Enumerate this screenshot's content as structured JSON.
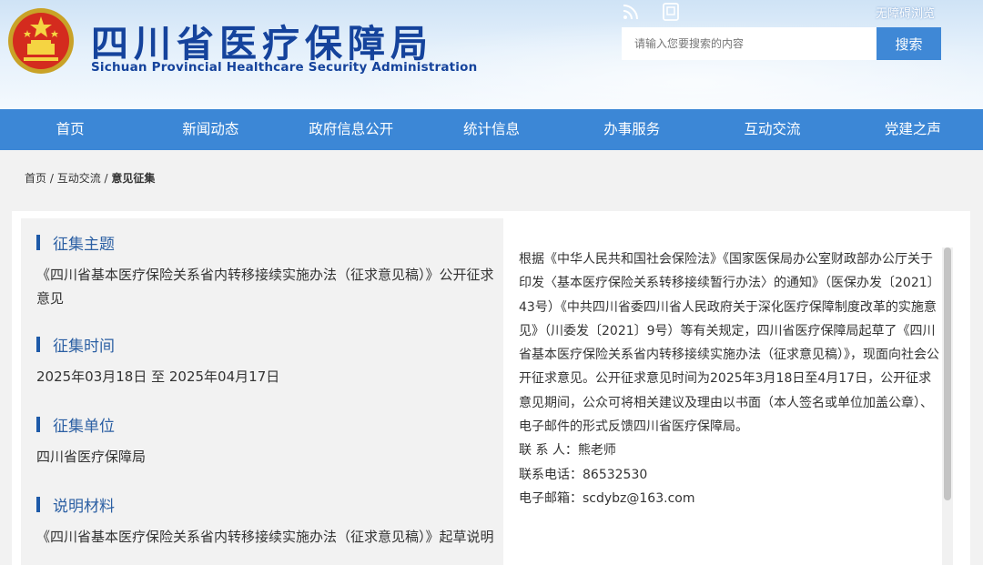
{
  "header": {
    "title": "四川省医疗保障局",
    "subtitle": "Sichuan Provincial Healthcare Security Administration",
    "accessibility": "无障碍浏览",
    "search_placeholder": "请输入您要搜索的内容",
    "search_button": "搜索",
    "icons": [
      "rss-icon",
      "mobile-icon"
    ]
  },
  "nav": {
    "items": [
      "首页",
      "新闻动态",
      "政府信息公开",
      "统计信息",
      "办事服务",
      "互动交流",
      "党建之声"
    ]
  },
  "breadcrumb": [
    "首页",
    "互动交流",
    "意见征集"
  ],
  "sections": [
    {
      "title": "征集主题",
      "content": "《四川省基本医疗保险关系省内转移接续实施办法（征求意见稿）》公开征求意见"
    },
    {
      "title": "征集时间",
      "content": "2025年03月18日 至 2025年04月17日"
    },
    {
      "title": "征集单位",
      "content": "四川省医疗保障局"
    },
    {
      "title": "说明材料",
      "content": "《四川省基本医疗保险关系省内转移接续实施办法（征求意见稿）》起草说明"
    }
  ],
  "description": {
    "body": "根据《中华人民共和国社会保险法》《国家医保局办公室财政部办公厅关于印发〈基本医疗保险关系转移接续暂行办法〉的通知》（医保办发〔2021〕43号）《中共四川省委四川省人民政府关于深化医疗保障制度改革的实施意见》（川委发〔2021〕9号）等有关规定，四川省医疗保障局起草了《四川省基本医疗保险关系省内转移接续实施办法（征求意见稿）》，现面向社会公开征求意见。公开征求意见时间为2025年3月18日至4月17日，公开征求意见期间，公众可将相关建议及理由以书面（本人签名或单位加盖公章）、电子邮件的形式反馈四川省医疗保障局。",
    "contact": "联 系 人：熊老师",
    "phone": "联系电话：86532530",
    "email": "电子邮箱：scdybz@163.com"
  },
  "colors": {
    "nav_bg": "#3c87d6",
    "title": "#15439c",
    "section_bar": "#1e5aa8",
    "search_button": "#3f88d6"
  }
}
